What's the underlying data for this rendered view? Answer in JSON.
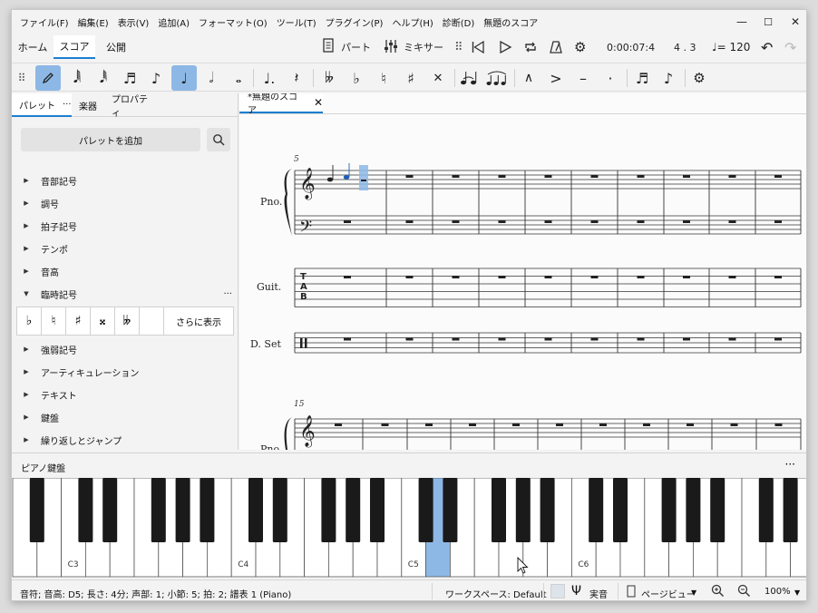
{
  "menu": [
    "ファイル(F)",
    "編集(E)",
    "表示(V)",
    "追加(A)",
    "フォーマット(O)",
    "ツール(T)",
    "プラグイン(P)",
    "ヘルプ(H)",
    "診断(D)",
    "無題のスコア"
  ],
  "window_controls": {
    "minimize": "—",
    "maximize": "☐",
    "close": "✕"
  },
  "tabs": {
    "home": "ホーム",
    "score": "スコア",
    "publish": "公開"
  },
  "toolbar": {
    "parts_label": "パート",
    "mixer_label": "ミキサー",
    "time": "0:00:07:4",
    "position": "4 . 3",
    "tempo": "♩= 120"
  },
  "note_input": {
    "icons": [
      "pen-icon",
      "64th-note-icon",
      "32nd-note-icon",
      "16th-note-icon",
      "eighth-note-icon",
      "quarter-note-icon",
      "half-note-icon",
      "whole-note-icon",
      "dotted-note-icon",
      "rest-icon",
      "double-flat-icon",
      "flat-icon",
      "natural-icon",
      "sharp-icon",
      "double-sharp-icon",
      "tie-icon",
      "slur-icon",
      "marcato-icon",
      "accent-icon",
      "tenuto-icon",
      "staccato-icon",
      "tuplet-icon",
      "flip-icon",
      "gear-icon"
    ],
    "active_duration": "quarter"
  },
  "left_panel": {
    "tabs": [
      "パレット",
      "楽器",
      "プロパティ"
    ],
    "tab_dots": "···",
    "add_palette": "パレットを追加",
    "palettes": [
      "音部記号",
      "調号",
      "拍子記号",
      "テンポ",
      "音高",
      "臨時記号",
      "強弱記号",
      "アーティキュレーション",
      "テキスト",
      "鍵盤",
      "繰り返しとジャンプ"
    ],
    "expanded": "臨時記号",
    "expanded_dots": "···",
    "accidentals": [
      "♭",
      "♮",
      "♯",
      "𝄪",
      "𝄫"
    ],
    "show_more": "さらに表示"
  },
  "document": {
    "tab_title": "*無題のスコア",
    "system1": {
      "measure_number": "5",
      "staves": [
        "Pno.",
        "Guit.",
        "D. Set"
      ],
      "tab_label": "T\nA\nB"
    },
    "system2": {
      "measure_number": "15",
      "staves": [
        "Pno."
      ]
    }
  },
  "piano": {
    "title": "ピアノ鍵盤",
    "dots": "···",
    "labels": [
      "C3",
      "C4",
      "C5",
      "C6"
    ],
    "highlighted_key": "D5",
    "highlight_color": "#8db8e6"
  },
  "status": {
    "info": "音符; 音高: D5; 長さ: 4分; 声部: 1; 小節: 5; 拍: 2; 譜表 1 (Piano)",
    "workspace": "ワークスペース: Default",
    "concert_pitch": "実音",
    "view_mode": "ページビュー",
    "zoom": "100%"
  },
  "colors": {
    "accent": "#1d7fd0",
    "active": "#8db8e6"
  }
}
